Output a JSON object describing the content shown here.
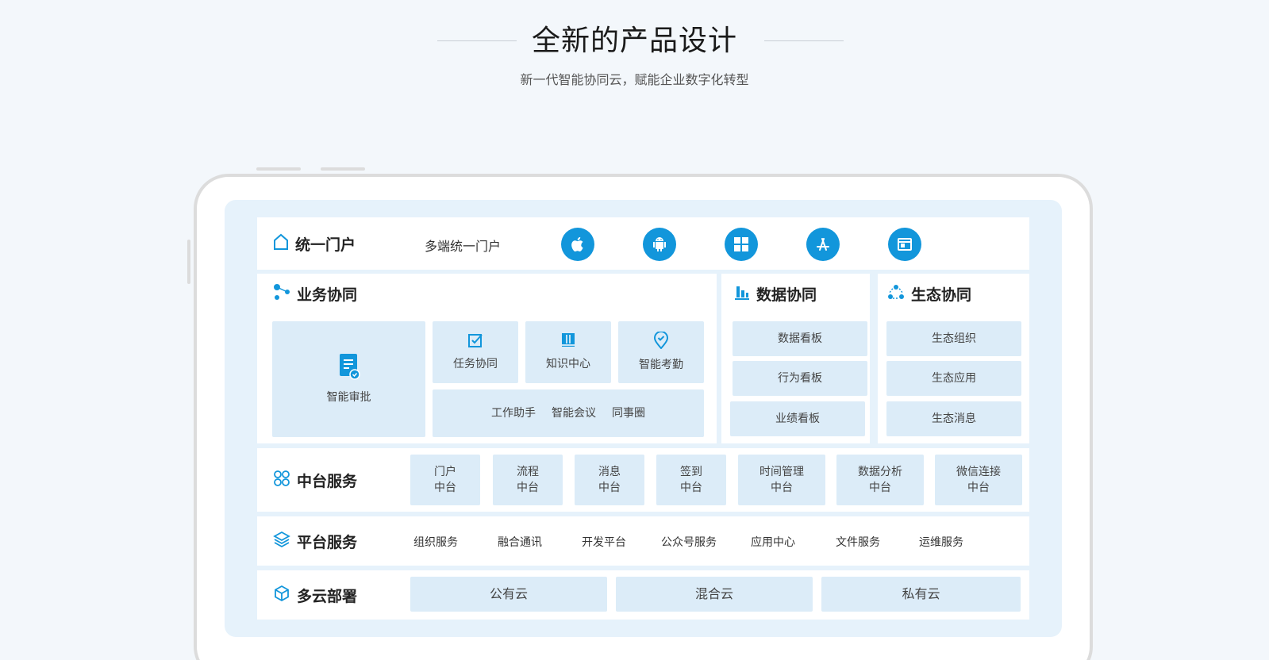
{
  "hero": {
    "title": "全新的产品设计",
    "subtitle": "新一代智能协同云，赋能企业数字化转型"
  },
  "portal": {
    "title": "统一门户",
    "label": "多端统一门户",
    "platforms": [
      "apple-icon",
      "android-icon",
      "windows-icon",
      "app-store-icon",
      "browser-icon"
    ]
  },
  "business": {
    "title": "业务协同",
    "approval": "智能审批",
    "items": [
      "任务协同",
      "知识中心",
      "智能考勤"
    ],
    "tools": [
      "工作助手",
      "智能会议",
      "同事圈"
    ]
  },
  "data_collab": {
    "title": "数据协同",
    "items": [
      "数据看板",
      "行为看板",
      "业绩看板"
    ]
  },
  "eco": {
    "title": "生态协同",
    "items": [
      "生态组织",
      "生态应用",
      "生态消息"
    ]
  },
  "middle": {
    "title": "中台服务",
    "items": [
      {
        "l1": "门户",
        "l2": "中台"
      },
      {
        "l1": "流程",
        "l2": "中台"
      },
      {
        "l1": "消息",
        "l2": "中台"
      },
      {
        "l1": "签到",
        "l2": "中台"
      },
      {
        "l1": "时间管理",
        "l2": "中台"
      },
      {
        "l1": "数据分析",
        "l2": "中台"
      },
      {
        "l1": "微信连接",
        "l2": "中台"
      }
    ]
  },
  "platform": {
    "title": "平台服务",
    "items": [
      "组织服务",
      "融合通讯",
      "开发平台",
      "公众号服务",
      "应用中心",
      "文件服务",
      "运维服务"
    ]
  },
  "cloud": {
    "title": "多云部署",
    "items": [
      "公有云",
      "混合云",
      "私有云"
    ]
  },
  "colors": {
    "accent": "#1296db",
    "chip_bg": "#dcecf8",
    "screen_bg": "#e6f2fb"
  }
}
